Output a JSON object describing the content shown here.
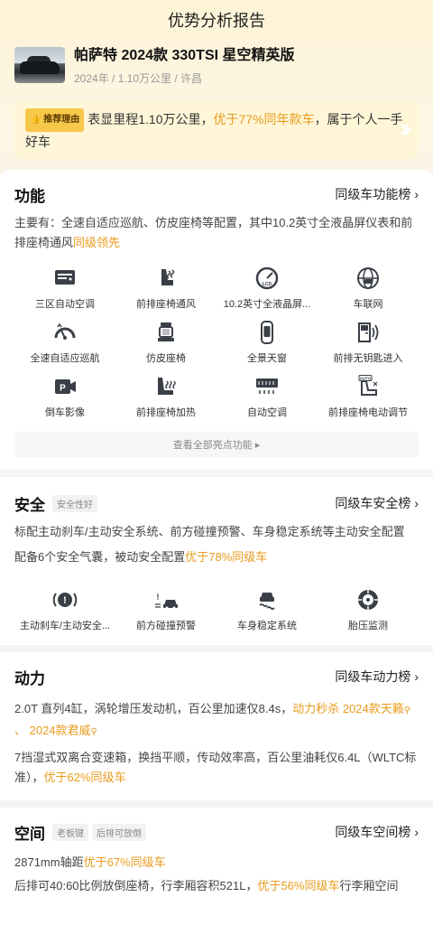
{
  "header": {
    "title": "优势分析报告"
  },
  "car": {
    "name": "帕萨特 2024款 330TSI 星空精英版",
    "meta": "2024年 / 1.10万公里 / 许昌"
  },
  "recommend": {
    "tag": "推荐理由",
    "text_a": "表显里程1.10万公里，",
    "text_highlight": "优于77%同年款车",
    "text_b": "，属于个人一手好车"
  },
  "function": {
    "title": "功能",
    "link": "同级车功能榜",
    "desc_a": "主要有：全速自适应巡航、仿皮座椅等配置，其中10.2英寸全液晶屏仪表和前排座椅通风",
    "desc_highlight": "同级领先",
    "features": [
      {
        "label": "三区自动空调",
        "icon": "ac-panel-icon"
      },
      {
        "label": "前排座椅通风",
        "icon": "seat-ventilation-icon"
      },
      {
        "label": "10.2英寸全液晶屏...",
        "icon": "lcd-gauge-icon"
      },
      {
        "label": "车联网",
        "icon": "connected-car-icon"
      },
      {
        "label": "全速自适应巡航",
        "icon": "adaptive-cruise-icon"
      },
      {
        "label": "仿皮座椅",
        "icon": "leather-seat-icon"
      },
      {
        "label": "全景天窗",
        "icon": "sunroof-icon"
      },
      {
        "label": "前排无钥匙进入",
        "icon": "keyless-entry-icon"
      },
      {
        "label": "倒车影像",
        "icon": "reverse-camera-icon"
      },
      {
        "label": "前排座椅加热",
        "icon": "seat-heating-icon"
      },
      {
        "label": "自动空调",
        "icon": "auto-ac-icon"
      },
      {
        "label": "前排座椅电动调节",
        "icon": "power-seat-icon"
      }
    ],
    "all_button": "查看全部亮点功能 ▸"
  },
  "safety": {
    "title": "安全",
    "badge": "安全性好",
    "link": "同级车安全榜",
    "desc1": "标配主动刹车/主动安全系统、前方碰撞预警、车身稳定系统等主动安全配置",
    "desc2_a": "配备6个安全气囊，被动安全配置",
    "desc2_highlight": "优于78%同级车",
    "features": [
      {
        "label": "主动刹车/主动安全...",
        "icon": "active-brake-icon"
      },
      {
        "label": "前方碰撞预警",
        "icon": "collision-warning-icon"
      },
      {
        "label": "车身稳定系统",
        "icon": "stability-control-icon"
      },
      {
        "label": "胎压监测",
        "icon": "tire-pressure-icon"
      }
    ]
  },
  "power": {
    "title": "动力",
    "link": "同级车动力榜",
    "desc1_a": "2.0T 直列4缸，涡轮增压发动机，百公里加速仅8.4s，",
    "desc1_highlight": "动力秒杀 2024款天籁",
    "desc1_highlight2": "2024款君威",
    "desc2_a": "7挡湿式双离合变速箱，换挡平顺，传动效率高，百公里油耗仅6.4L（WLTC标准），",
    "desc2_highlight": "优于62%同级车"
  },
  "space": {
    "title": "空间",
    "badge1": "老板键",
    "badge2": "后排可放倒",
    "link": "同级车空间榜",
    "desc1_a": "2871mm轴距",
    "desc1_highlight": "优于67%同级车",
    "desc2_a": "后排可40:60比例放倒座椅，行李厢容积521L，",
    "desc2_highlight": "优于56%同级车",
    "desc2_b": "行李厢空间"
  }
}
